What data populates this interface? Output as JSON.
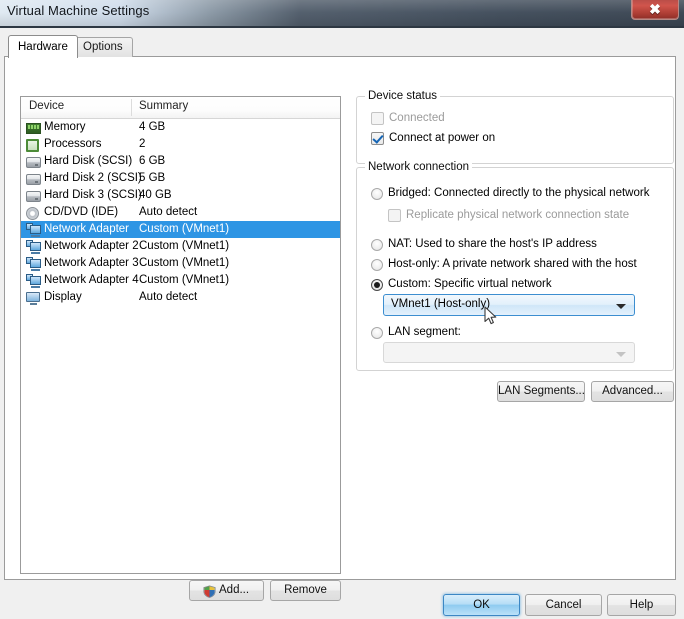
{
  "window": {
    "title": "Virtual Machine Settings",
    "close_glyph": "✖"
  },
  "tabs": [
    {
      "label": "Hardware",
      "active": true
    },
    {
      "label": "Options",
      "active": false
    }
  ],
  "device_list": {
    "columns": [
      "Device",
      "Summary"
    ],
    "rows": [
      {
        "icon": "memory-icon",
        "device": "Memory",
        "summary": "4 GB",
        "selected": false
      },
      {
        "icon": "processor-icon",
        "device": "Processors",
        "summary": "2",
        "selected": false
      },
      {
        "icon": "hard-disk-icon",
        "device": "Hard Disk (SCSI)",
        "summary": "6 GB",
        "selected": false
      },
      {
        "icon": "hard-disk-icon",
        "device": "Hard Disk 2 (SCSI)",
        "summary": "5 GB",
        "selected": false
      },
      {
        "icon": "hard-disk-icon",
        "device": "Hard Disk 3 (SCSI)",
        "summary": "40 GB",
        "selected": false
      },
      {
        "icon": "cd-dvd-icon",
        "device": "CD/DVD (IDE)",
        "summary": "Auto detect",
        "selected": false
      },
      {
        "icon": "network-adapter-icon",
        "device": "Network Adapter",
        "summary": "Custom (VMnet1)",
        "selected": true
      },
      {
        "icon": "network-adapter-icon",
        "device": "Network Adapter 2",
        "summary": "Custom (VMnet1)",
        "selected": false
      },
      {
        "icon": "network-adapter-icon",
        "device": "Network Adapter 3",
        "summary": "Custom (VMnet1)",
        "selected": false
      },
      {
        "icon": "network-adapter-icon",
        "device": "Network Adapter 4",
        "summary": "Custom (VMnet1)",
        "selected": false
      },
      {
        "icon": "display-icon",
        "device": "Display",
        "summary": "Auto detect",
        "selected": false
      }
    ],
    "add_label": "Add...",
    "remove_label": "Remove"
  },
  "device_status": {
    "group_title": "Device status",
    "connected_label": "Connected",
    "connected_checked": false,
    "connected_enabled": false,
    "connect_at_power_on_label": "Connect at power on",
    "connect_at_power_on_checked": true
  },
  "network_connection": {
    "group_title": "Network connection",
    "options": [
      {
        "label": "Bridged: Connected directly to the physical network",
        "selected": false
      },
      {
        "label": "NAT: Used to share the host's IP address",
        "selected": false
      },
      {
        "label": "Host-only: A private network shared with the host",
        "selected": false
      },
      {
        "label": "Custom: Specific virtual network",
        "selected": false
      },
      {
        "label": "LAN segment:",
        "selected": false
      }
    ],
    "bridged_label": "Bridged: Connected directly to the physical network",
    "replicate_label": "Replicate physical network connection state",
    "replicate_checked": false,
    "nat_label": "NAT: Used to share the host's IP address",
    "host_only_label": "Host-only: A private network shared with the host",
    "custom_label": "Custom: Specific virtual network",
    "custom_selected": true,
    "custom_network_value": "VMnet1 (Host-only)",
    "lan_segment_label": "LAN segment:",
    "lan_segment_value": "",
    "lan_segments_button": "LAN Segments...",
    "advanced_button": "Advanced..."
  },
  "footer": {
    "ok_label": "OK",
    "cancel_label": "Cancel",
    "help_label": "Help"
  },
  "colors": {
    "selection_blue": "#2e95e4",
    "accent_border": "#3c8ed0",
    "close_red": "#c0504a",
    "titlebar_dark": "#3b4653"
  }
}
